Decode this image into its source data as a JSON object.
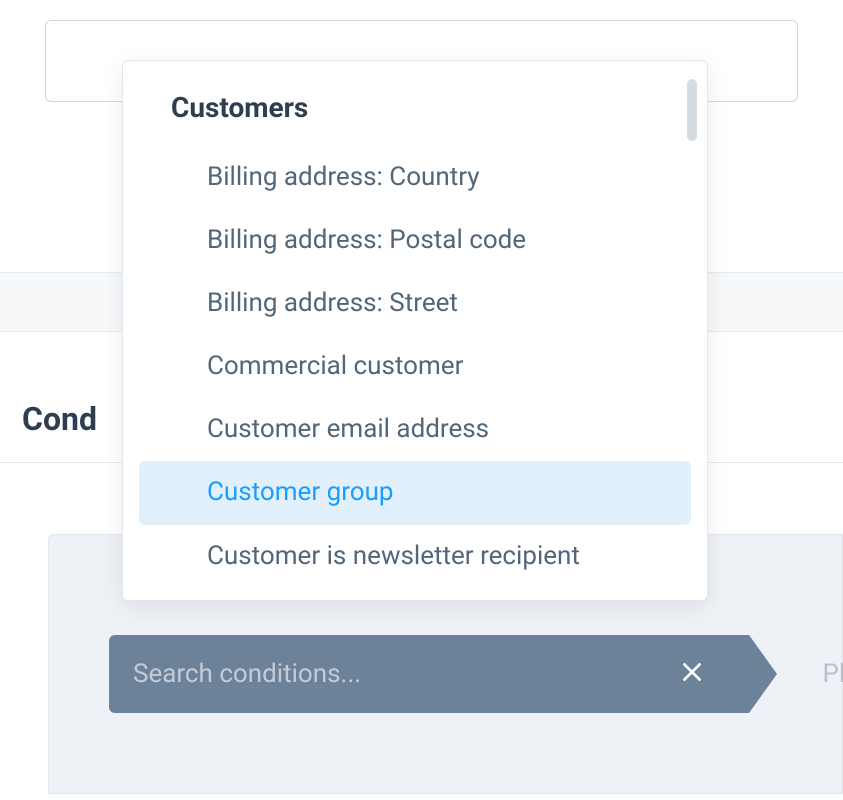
{
  "top_input": {
    "value": "",
    "placeholder": ""
  },
  "section": {
    "heading": "Cond"
  },
  "search": {
    "placeholder": "Search conditions...",
    "next_placeholder": "Ple"
  },
  "dropdown": {
    "group_label": "Customers",
    "items": [
      {
        "label": "Billing address: Country",
        "highlighted": false
      },
      {
        "label": "Billing address: Postal code",
        "highlighted": false
      },
      {
        "label": "Billing address: Street",
        "highlighted": false
      },
      {
        "label": "Commercial customer",
        "highlighted": false
      },
      {
        "label": "Customer email address",
        "highlighted": false
      },
      {
        "label": "Customer group",
        "highlighted": true
      },
      {
        "label": "Customer is newsletter recipient",
        "highlighted": false
      }
    ]
  }
}
